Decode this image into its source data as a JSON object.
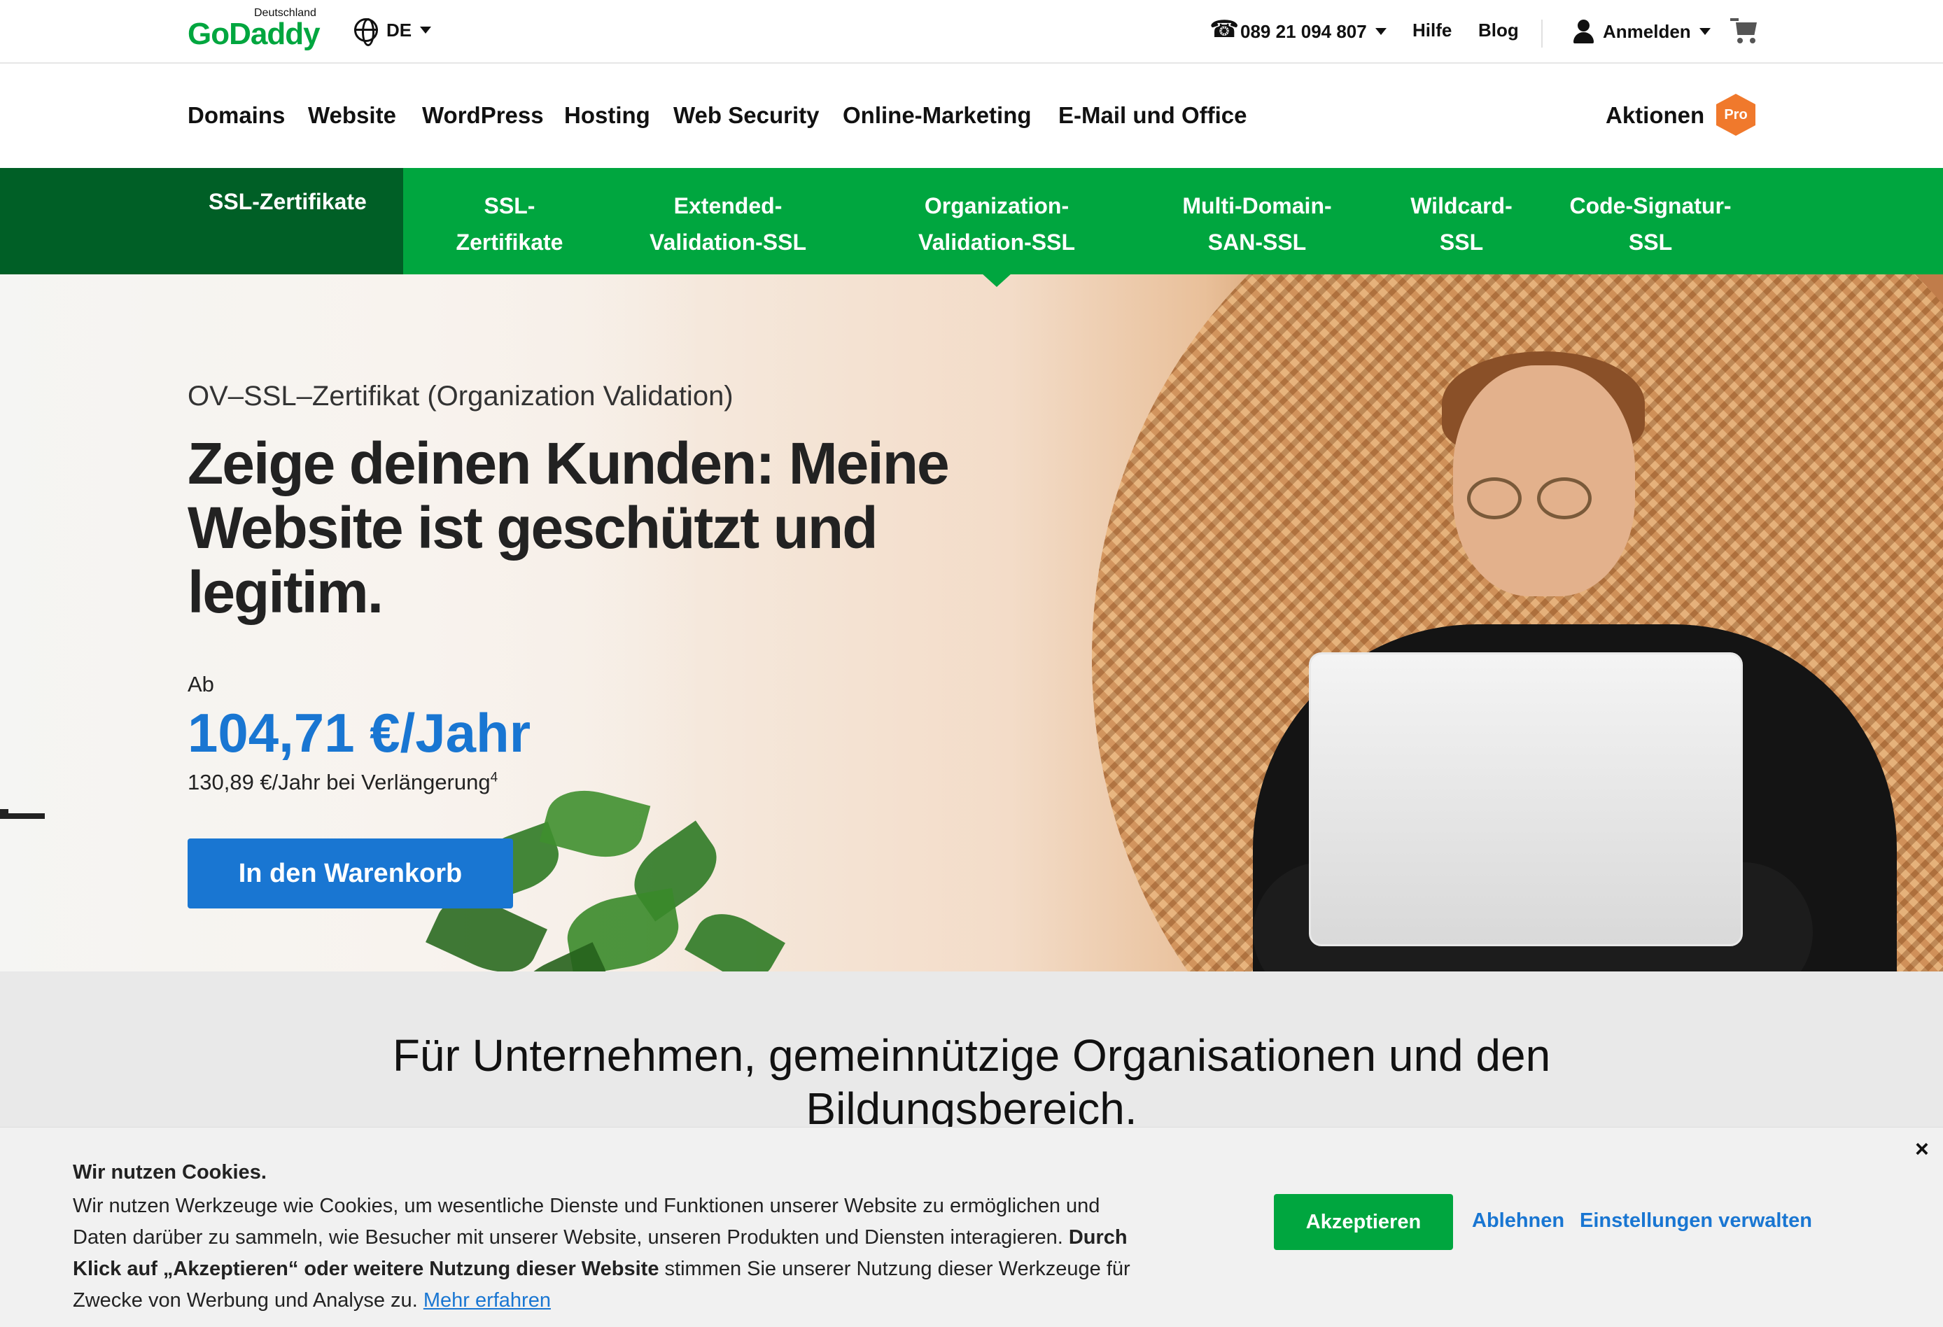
{
  "utility_bar": {
    "logo_country": "Deutschland",
    "logo_text": "GoDaddy",
    "language": "DE",
    "phone": "089 21 094 807",
    "help": "Hilfe",
    "blog": "Blog",
    "sign_in": "Anmelden"
  },
  "main_nav": {
    "items": [
      "Domains",
      "Website",
      "WordPress",
      "Hosting",
      "Web Security",
      "Online-Marketing",
      "E-Mail und Office"
    ],
    "promotions": "Aktionen",
    "pro_badge": "Pro"
  },
  "sub_nav": {
    "current": "SSL-Zertifikate",
    "tabs": [
      {
        "line1": "SSL-",
        "line2": "Zertifikate"
      },
      {
        "line1": "Extended-",
        "line2": "Validation-SSL"
      },
      {
        "line1": "Organization-",
        "line2": "Validation-SSL"
      },
      {
        "line1": "Multi-Domain-",
        "line2": "SAN-SSL"
      },
      {
        "line1": "Wildcard-",
        "line2": "SSL"
      },
      {
        "line1": "Code-Signatur-",
        "line2": "SSL"
      }
    ],
    "active_tab": "Organization-Validation-SSL"
  },
  "hero": {
    "eyebrow": "OV–SSL–Zertifikat (Organization Validation)",
    "headline": "Zeige deinen Kunden: Meine Website ist geschützt und legitim.",
    "price_prefix": "Ab",
    "price": "104,71 €/Jahr",
    "renewal": "130,89 €/Jahr bei Verlängerung",
    "renewal_footnote": "4",
    "cta": "In den Warenkorb"
  },
  "section": {
    "heading_line1": "Für Unternehmen, gemeinnützige Organisationen und den",
    "heading_line2": "Bildungsbereich."
  },
  "cookie_banner": {
    "title": "Wir nutzen Cookies.",
    "text_part1": "Wir nutzen Werkzeuge wie Cookies, um wesentliche Dienste und Funktionen unserer Website zu ermöglichen und Daten darüber zu sammeln, wie Besucher mit unserer Website, unseren Produkten und Diensten interagieren.",
    "text_bold": "Durch Klick auf „Akzeptieren“ oder weitere Nutzung dieser Website",
    "text_part2": "stimmen Sie unserer Nutzung dieser Werkzeuge für Zwecke von Werbung und Analyse zu.",
    "learn_more": "Mehr erfahren",
    "accept": "Akzeptieren",
    "decline": "Ablehnen",
    "manage": "Einstellungen verwalten",
    "close": "×"
  },
  "colors": {
    "brand_green": "#00a63f",
    "dark_green": "#005f26",
    "link_blue": "#1976d2",
    "pro_orange": "#f0792c"
  }
}
